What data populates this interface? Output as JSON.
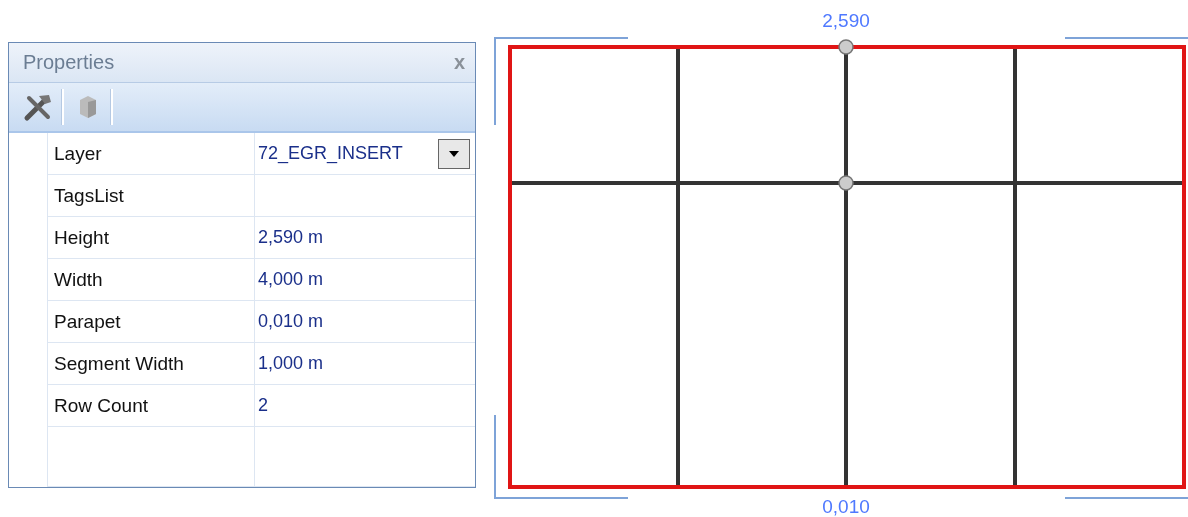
{
  "panel": {
    "title": "Properties",
    "close": "x"
  },
  "properties": [
    {
      "name": "Layer",
      "value": "72_EGR_INSERT",
      "kind": "dropdown"
    },
    {
      "name": "TagsList",
      "kind": "text"
    },
    {
      "name": "Height",
      "value": "2,590 m",
      "kind": "text"
    },
    {
      "name": "Width",
      "value": "4,000 m",
      "kind": "text"
    },
    {
      "name": "Parapet",
      "value": "0,010 m",
      "kind": "text"
    },
    {
      "name": "Segment Width",
      "value": "1,000 m",
      "kind": "text"
    },
    {
      "name": "Row Count",
      "value": "2",
      "kind": "text"
    }
  ],
  "drawing": {
    "top_dimension": {
      "label": "2,590"
    },
    "bottom_dimension": {
      "label": "0,010"
    }
  }
}
